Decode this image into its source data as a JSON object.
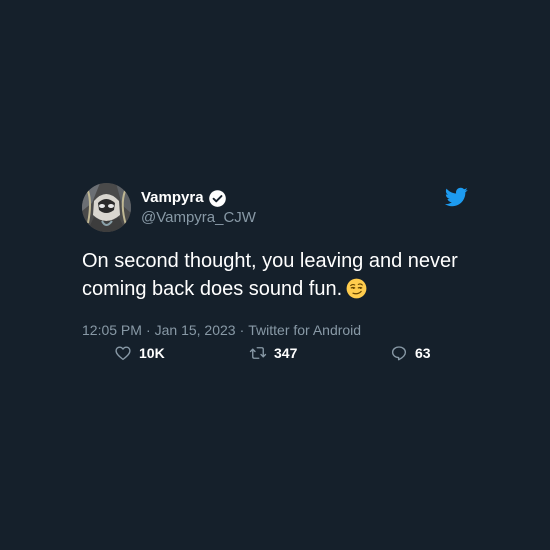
{
  "tweet": {
    "display_name": "Vampyra",
    "handle": "@Vampyra_CJW",
    "text": "On second thought, you leaving and never coming back does sound fun.",
    "emoji": "smirking-face",
    "time": "12:05 PM",
    "date": "Jan 15, 2023",
    "source": "Twitter for Android",
    "separator": "·",
    "likes": "10K",
    "retweets": "347",
    "replies": "63"
  },
  "icons": {
    "verified": "verified-badge-icon",
    "logo": "twitter-bird-icon",
    "like": "heart-icon",
    "retweet": "retweet-icon",
    "reply": "reply-icon"
  },
  "colors": {
    "background": "#15202b",
    "text": "#ffffff",
    "secondary": "#8899a6",
    "brand": "#1d9bf0"
  }
}
